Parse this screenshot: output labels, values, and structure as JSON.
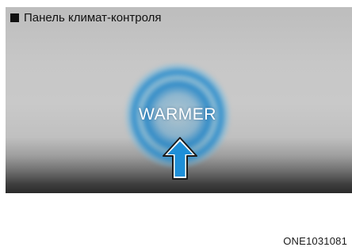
{
  "caption": {
    "icon": "black-square-icon",
    "text": "Панель климат-контроля"
  },
  "control": {
    "label": "WARMER",
    "icon": "up-arrow-icon",
    "accent": "#1e8fd8"
  },
  "figure": {
    "code": "ONE1031081"
  }
}
